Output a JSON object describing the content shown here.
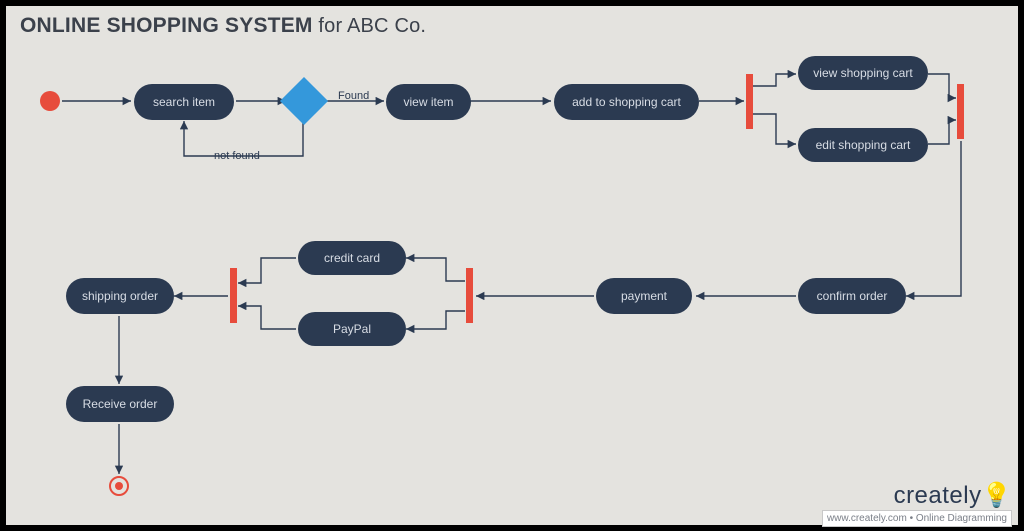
{
  "title_main": "ONLINE SHOPPING SYSTEM",
  "title_sub": " for ABC Co.",
  "nodes": {
    "search_item": "search item",
    "view_item": "view item",
    "add_to_cart": "add to shopping cart",
    "view_cart": "view shopping cart",
    "edit_cart": "edit shopping cart",
    "confirm_order": "confirm order",
    "payment": "payment",
    "credit_card": "credit card",
    "paypal": "PayPal",
    "shipping_order": "shipping order",
    "receive_order": "Receive order"
  },
  "edge_labels": {
    "found": "Found",
    "not_found": "not found"
  },
  "watermark": {
    "brand": "creately",
    "tagline": "www.creately.com • Online Diagramming"
  },
  "colors": {
    "node_fill": "#2B3A51",
    "accent_red": "#E74C3C",
    "accent_blue": "#3498DB",
    "bg": "#E4E3DF"
  }
}
